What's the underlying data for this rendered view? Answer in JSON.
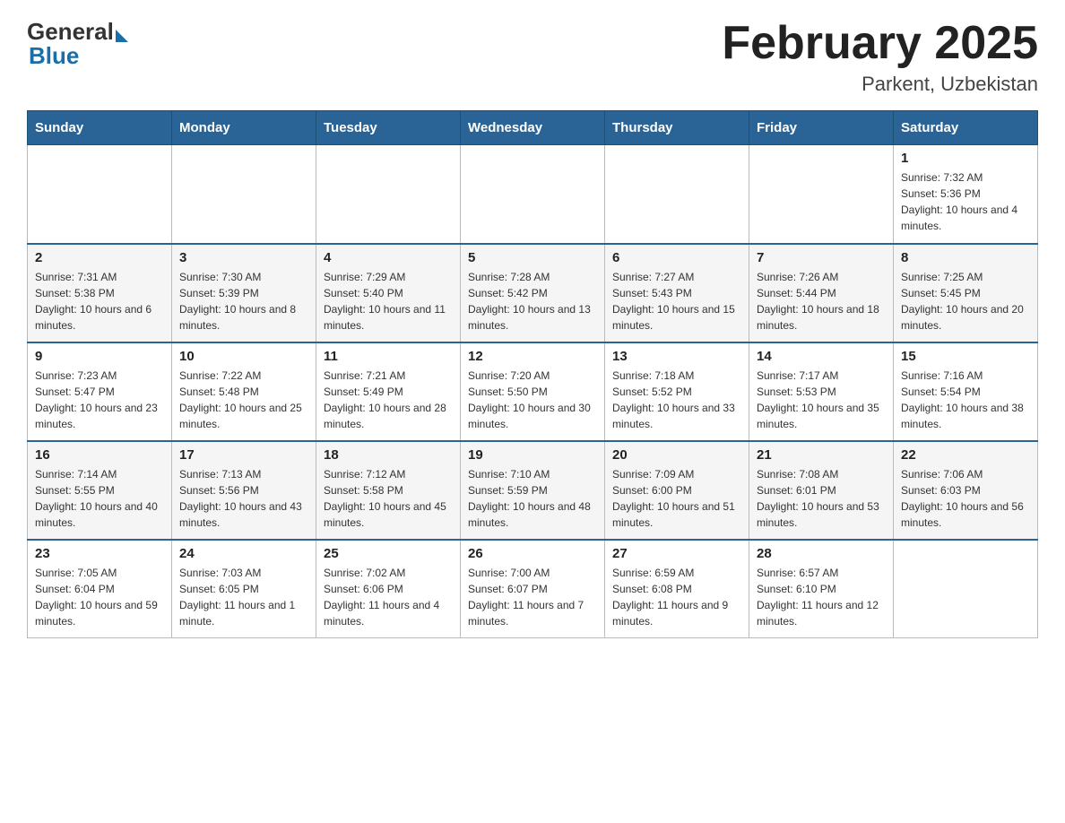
{
  "logo": {
    "general": "General",
    "blue": "Blue"
  },
  "header": {
    "title": "February 2025",
    "subtitle": "Parkent, Uzbekistan"
  },
  "weekdays": [
    "Sunday",
    "Monday",
    "Tuesday",
    "Wednesday",
    "Thursday",
    "Friday",
    "Saturday"
  ],
  "weeks": [
    [
      {
        "day": "",
        "info": ""
      },
      {
        "day": "",
        "info": ""
      },
      {
        "day": "",
        "info": ""
      },
      {
        "day": "",
        "info": ""
      },
      {
        "day": "",
        "info": ""
      },
      {
        "day": "",
        "info": ""
      },
      {
        "day": "1",
        "info": "Sunrise: 7:32 AM\nSunset: 5:36 PM\nDaylight: 10 hours and 4 minutes."
      }
    ],
    [
      {
        "day": "2",
        "info": "Sunrise: 7:31 AM\nSunset: 5:38 PM\nDaylight: 10 hours and 6 minutes."
      },
      {
        "day": "3",
        "info": "Sunrise: 7:30 AM\nSunset: 5:39 PM\nDaylight: 10 hours and 8 minutes."
      },
      {
        "day": "4",
        "info": "Sunrise: 7:29 AM\nSunset: 5:40 PM\nDaylight: 10 hours and 11 minutes."
      },
      {
        "day": "5",
        "info": "Sunrise: 7:28 AM\nSunset: 5:42 PM\nDaylight: 10 hours and 13 minutes."
      },
      {
        "day": "6",
        "info": "Sunrise: 7:27 AM\nSunset: 5:43 PM\nDaylight: 10 hours and 15 minutes."
      },
      {
        "day": "7",
        "info": "Sunrise: 7:26 AM\nSunset: 5:44 PM\nDaylight: 10 hours and 18 minutes."
      },
      {
        "day": "8",
        "info": "Sunrise: 7:25 AM\nSunset: 5:45 PM\nDaylight: 10 hours and 20 minutes."
      }
    ],
    [
      {
        "day": "9",
        "info": "Sunrise: 7:23 AM\nSunset: 5:47 PM\nDaylight: 10 hours and 23 minutes."
      },
      {
        "day": "10",
        "info": "Sunrise: 7:22 AM\nSunset: 5:48 PM\nDaylight: 10 hours and 25 minutes."
      },
      {
        "day": "11",
        "info": "Sunrise: 7:21 AM\nSunset: 5:49 PM\nDaylight: 10 hours and 28 minutes."
      },
      {
        "day": "12",
        "info": "Sunrise: 7:20 AM\nSunset: 5:50 PM\nDaylight: 10 hours and 30 minutes."
      },
      {
        "day": "13",
        "info": "Sunrise: 7:18 AM\nSunset: 5:52 PM\nDaylight: 10 hours and 33 minutes."
      },
      {
        "day": "14",
        "info": "Sunrise: 7:17 AM\nSunset: 5:53 PM\nDaylight: 10 hours and 35 minutes."
      },
      {
        "day": "15",
        "info": "Sunrise: 7:16 AM\nSunset: 5:54 PM\nDaylight: 10 hours and 38 minutes."
      }
    ],
    [
      {
        "day": "16",
        "info": "Sunrise: 7:14 AM\nSunset: 5:55 PM\nDaylight: 10 hours and 40 minutes."
      },
      {
        "day": "17",
        "info": "Sunrise: 7:13 AM\nSunset: 5:56 PM\nDaylight: 10 hours and 43 minutes."
      },
      {
        "day": "18",
        "info": "Sunrise: 7:12 AM\nSunset: 5:58 PM\nDaylight: 10 hours and 45 minutes."
      },
      {
        "day": "19",
        "info": "Sunrise: 7:10 AM\nSunset: 5:59 PM\nDaylight: 10 hours and 48 minutes."
      },
      {
        "day": "20",
        "info": "Sunrise: 7:09 AM\nSunset: 6:00 PM\nDaylight: 10 hours and 51 minutes."
      },
      {
        "day": "21",
        "info": "Sunrise: 7:08 AM\nSunset: 6:01 PM\nDaylight: 10 hours and 53 minutes."
      },
      {
        "day": "22",
        "info": "Sunrise: 7:06 AM\nSunset: 6:03 PM\nDaylight: 10 hours and 56 minutes."
      }
    ],
    [
      {
        "day": "23",
        "info": "Sunrise: 7:05 AM\nSunset: 6:04 PM\nDaylight: 10 hours and 59 minutes."
      },
      {
        "day": "24",
        "info": "Sunrise: 7:03 AM\nSunset: 6:05 PM\nDaylight: 11 hours and 1 minute."
      },
      {
        "day": "25",
        "info": "Sunrise: 7:02 AM\nSunset: 6:06 PM\nDaylight: 11 hours and 4 minutes."
      },
      {
        "day": "26",
        "info": "Sunrise: 7:00 AM\nSunset: 6:07 PM\nDaylight: 11 hours and 7 minutes."
      },
      {
        "day": "27",
        "info": "Sunrise: 6:59 AM\nSunset: 6:08 PM\nDaylight: 11 hours and 9 minutes."
      },
      {
        "day": "28",
        "info": "Sunrise: 6:57 AM\nSunset: 6:10 PM\nDaylight: 11 hours and 12 minutes."
      },
      {
        "day": "",
        "info": ""
      }
    ]
  ]
}
